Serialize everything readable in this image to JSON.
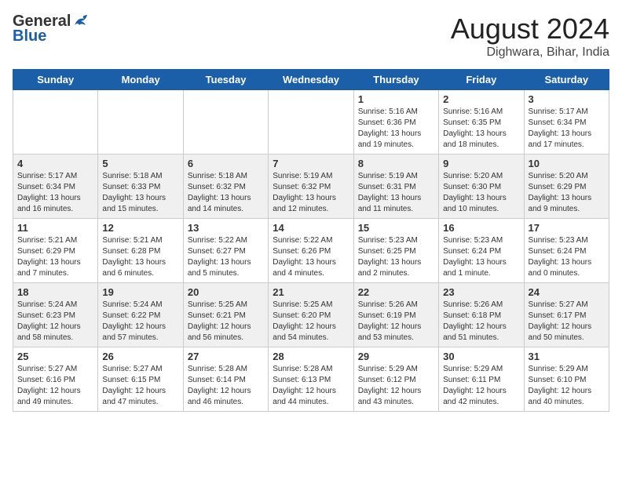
{
  "header": {
    "logo_general": "General",
    "logo_blue": "Blue",
    "month_year": "August 2024",
    "location": "Dighwara, Bihar, India"
  },
  "weekdays": [
    "Sunday",
    "Monday",
    "Tuesday",
    "Wednesday",
    "Thursday",
    "Friday",
    "Saturday"
  ],
  "weeks": [
    [
      {
        "day": "",
        "detail": ""
      },
      {
        "day": "",
        "detail": ""
      },
      {
        "day": "",
        "detail": ""
      },
      {
        "day": "",
        "detail": ""
      },
      {
        "day": "1",
        "detail": "Sunrise: 5:16 AM\nSunset: 6:36 PM\nDaylight: 13 hours\nand 19 minutes."
      },
      {
        "day": "2",
        "detail": "Sunrise: 5:16 AM\nSunset: 6:35 PM\nDaylight: 13 hours\nand 18 minutes."
      },
      {
        "day": "3",
        "detail": "Sunrise: 5:17 AM\nSunset: 6:34 PM\nDaylight: 13 hours\nand 17 minutes."
      }
    ],
    [
      {
        "day": "4",
        "detail": "Sunrise: 5:17 AM\nSunset: 6:34 PM\nDaylight: 13 hours\nand 16 minutes."
      },
      {
        "day": "5",
        "detail": "Sunrise: 5:18 AM\nSunset: 6:33 PM\nDaylight: 13 hours\nand 15 minutes."
      },
      {
        "day": "6",
        "detail": "Sunrise: 5:18 AM\nSunset: 6:32 PM\nDaylight: 13 hours\nand 14 minutes."
      },
      {
        "day": "7",
        "detail": "Sunrise: 5:19 AM\nSunset: 6:32 PM\nDaylight: 13 hours\nand 12 minutes."
      },
      {
        "day": "8",
        "detail": "Sunrise: 5:19 AM\nSunset: 6:31 PM\nDaylight: 13 hours\nand 11 minutes."
      },
      {
        "day": "9",
        "detail": "Sunrise: 5:20 AM\nSunset: 6:30 PM\nDaylight: 13 hours\nand 10 minutes."
      },
      {
        "day": "10",
        "detail": "Sunrise: 5:20 AM\nSunset: 6:29 PM\nDaylight: 13 hours\nand 9 minutes."
      }
    ],
    [
      {
        "day": "11",
        "detail": "Sunrise: 5:21 AM\nSunset: 6:29 PM\nDaylight: 13 hours\nand 7 minutes."
      },
      {
        "day": "12",
        "detail": "Sunrise: 5:21 AM\nSunset: 6:28 PM\nDaylight: 13 hours\nand 6 minutes."
      },
      {
        "day": "13",
        "detail": "Sunrise: 5:22 AM\nSunset: 6:27 PM\nDaylight: 13 hours\nand 5 minutes."
      },
      {
        "day": "14",
        "detail": "Sunrise: 5:22 AM\nSunset: 6:26 PM\nDaylight: 13 hours\nand 4 minutes."
      },
      {
        "day": "15",
        "detail": "Sunrise: 5:23 AM\nSunset: 6:25 PM\nDaylight: 13 hours\nand 2 minutes."
      },
      {
        "day": "16",
        "detail": "Sunrise: 5:23 AM\nSunset: 6:24 PM\nDaylight: 13 hours\nand 1 minute."
      },
      {
        "day": "17",
        "detail": "Sunrise: 5:23 AM\nSunset: 6:24 PM\nDaylight: 13 hours\nand 0 minutes."
      }
    ],
    [
      {
        "day": "18",
        "detail": "Sunrise: 5:24 AM\nSunset: 6:23 PM\nDaylight: 12 hours\nand 58 minutes."
      },
      {
        "day": "19",
        "detail": "Sunrise: 5:24 AM\nSunset: 6:22 PM\nDaylight: 12 hours\nand 57 minutes."
      },
      {
        "day": "20",
        "detail": "Sunrise: 5:25 AM\nSunset: 6:21 PM\nDaylight: 12 hours\nand 56 minutes."
      },
      {
        "day": "21",
        "detail": "Sunrise: 5:25 AM\nSunset: 6:20 PM\nDaylight: 12 hours\nand 54 minutes."
      },
      {
        "day": "22",
        "detail": "Sunrise: 5:26 AM\nSunset: 6:19 PM\nDaylight: 12 hours\nand 53 minutes."
      },
      {
        "day": "23",
        "detail": "Sunrise: 5:26 AM\nSunset: 6:18 PM\nDaylight: 12 hours\nand 51 minutes."
      },
      {
        "day": "24",
        "detail": "Sunrise: 5:27 AM\nSunset: 6:17 PM\nDaylight: 12 hours\nand 50 minutes."
      }
    ],
    [
      {
        "day": "25",
        "detail": "Sunrise: 5:27 AM\nSunset: 6:16 PM\nDaylight: 12 hours\nand 49 minutes."
      },
      {
        "day": "26",
        "detail": "Sunrise: 5:27 AM\nSunset: 6:15 PM\nDaylight: 12 hours\nand 47 minutes."
      },
      {
        "day": "27",
        "detail": "Sunrise: 5:28 AM\nSunset: 6:14 PM\nDaylight: 12 hours\nand 46 minutes."
      },
      {
        "day": "28",
        "detail": "Sunrise: 5:28 AM\nSunset: 6:13 PM\nDaylight: 12 hours\nand 44 minutes."
      },
      {
        "day": "29",
        "detail": "Sunrise: 5:29 AM\nSunset: 6:12 PM\nDaylight: 12 hours\nand 43 minutes."
      },
      {
        "day": "30",
        "detail": "Sunrise: 5:29 AM\nSunset: 6:11 PM\nDaylight: 12 hours\nand 42 minutes."
      },
      {
        "day": "31",
        "detail": "Sunrise: 5:29 AM\nSunset: 6:10 PM\nDaylight: 12 hours\nand 40 minutes."
      }
    ]
  ]
}
